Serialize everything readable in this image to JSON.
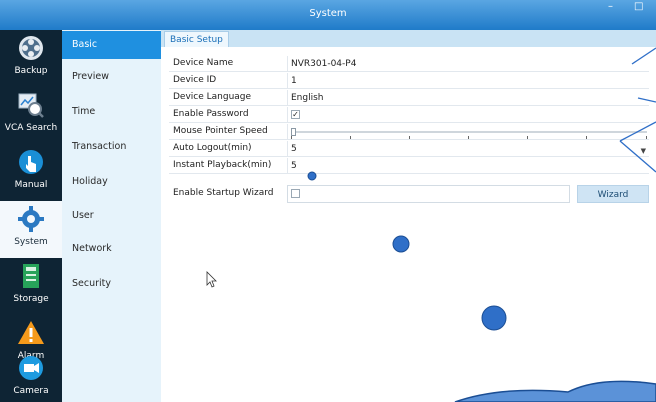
{
  "window": {
    "title": "System",
    "controls": [
      "–",
      "□"
    ]
  },
  "left_nav": [
    {
      "label": "Backup",
      "icon": "backup-icon"
    },
    {
      "label": "VCA Search",
      "icon": "vca-search-icon"
    },
    {
      "label": "Manual",
      "icon": "manual-icon"
    },
    {
      "label": "System",
      "icon": "system-gear-icon",
      "active": true
    },
    {
      "label": "Storage",
      "icon": "storage-icon"
    },
    {
      "label": "Alarm",
      "icon": "alarm-icon"
    },
    {
      "label": "Camera",
      "icon": "camera-icon"
    }
  ],
  "sub_nav": [
    {
      "label": "Basic",
      "active": true
    },
    {
      "label": "Preview"
    },
    {
      "label": "Time"
    },
    {
      "label": "Transaction"
    },
    {
      "label": "Holiday"
    },
    {
      "label": "User"
    },
    {
      "label": "Network"
    },
    {
      "label": "Security"
    }
  ],
  "tab": {
    "label": "Basic Setup"
  },
  "form": {
    "device_name": {
      "label": "Device Name",
      "value": "NVR301-04-P4"
    },
    "device_id": {
      "label": "Device ID",
      "value": "1"
    },
    "device_language": {
      "label": "Device Language",
      "value": "English"
    },
    "enable_password": {
      "label": "Enable Password",
      "checked": true,
      "mark": "✓"
    },
    "mouse_pointer_speed": {
      "label": "Mouse Pointer Speed",
      "level": 0
    },
    "auto_logout": {
      "label": "Auto Logout(min)",
      "value": "5"
    },
    "instant_playback": {
      "label": "Instant Playback(min)",
      "value": "5"
    },
    "startup_wizard": {
      "label": "Enable Startup Wizard",
      "checked": false,
      "button": "Wizard"
    }
  },
  "colors": {
    "titlebar": "#1f7bc9",
    "left_nav_bg": "#0e2434",
    "sub_nav_bg": "#e6f3fb",
    "sub_nav_active": "#1f90e0",
    "tab_bar": "#c9e3f4",
    "annotation_fill": "#2f6fc8"
  }
}
